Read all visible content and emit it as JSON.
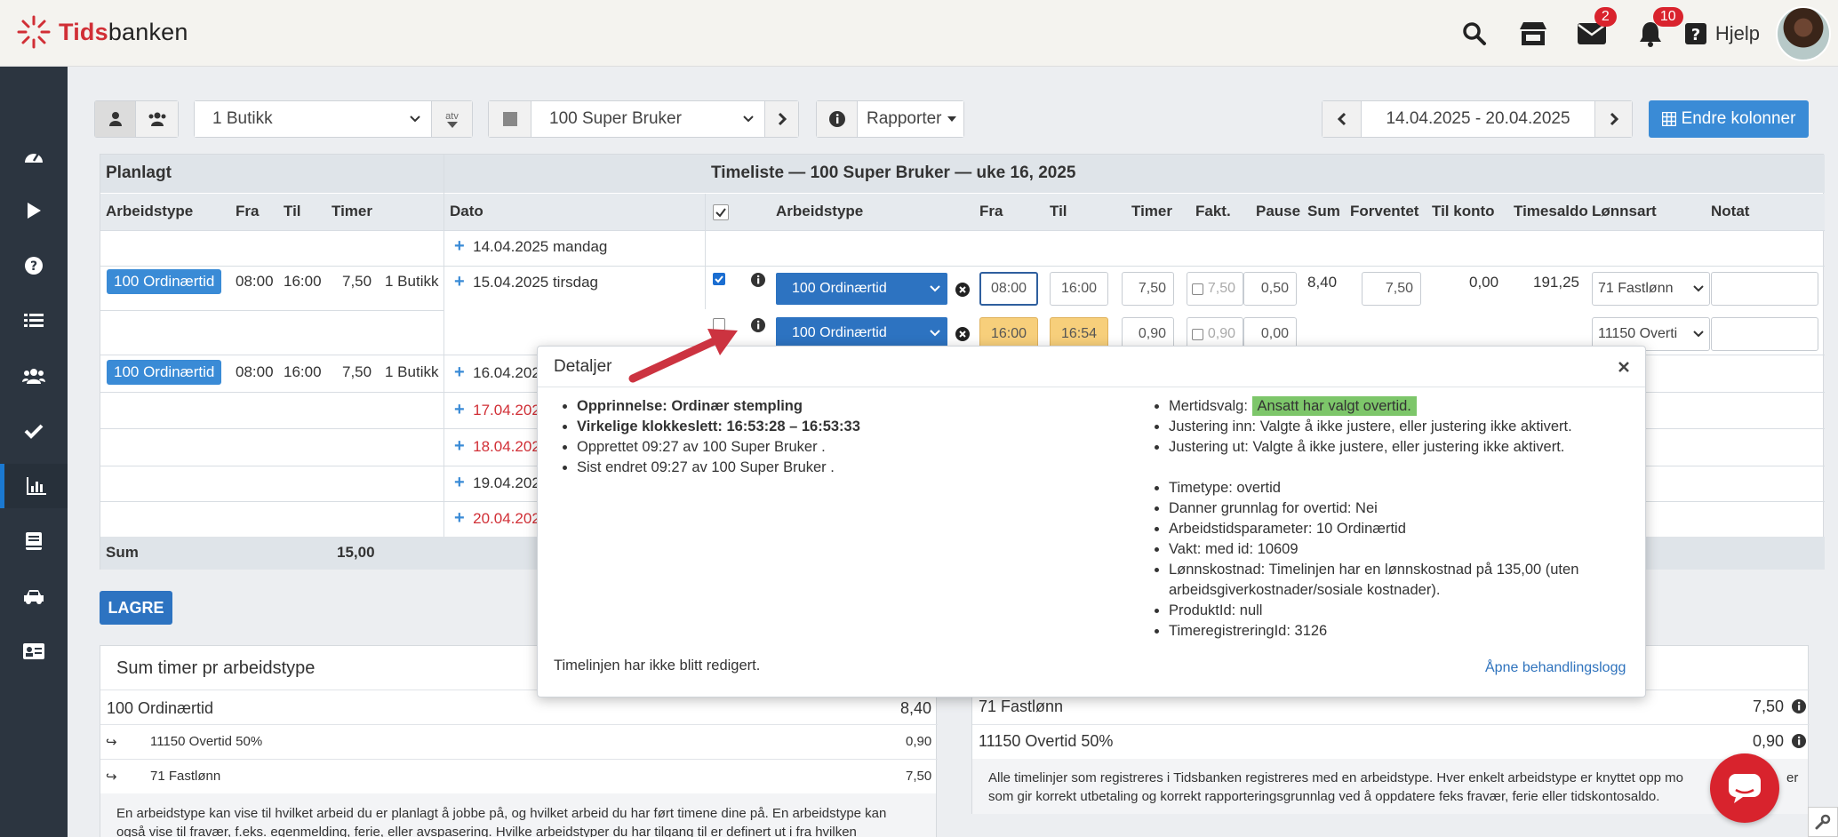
{
  "app": {
    "brand_red": "Tids",
    "brand_dark": "banken"
  },
  "topbar": {
    "messages_badge": "2",
    "notifications_badge": "10",
    "help_label": "Hjelp"
  },
  "toolbar": {
    "store_select": "1 Butikk",
    "atv_label": "atv",
    "user_select": "100 Super Bruker",
    "reports_label": "Rapporter",
    "date_range": "14.04.2025 - 20.04.2025",
    "change_columns_label": "Endre kolonner"
  },
  "table": {
    "planned_title": "Planlagt",
    "timesheet_title": "Timeliste — 100 Super Bruker — uke 16, 2025",
    "planned_headers": [
      "Arbeidstype",
      "Fra",
      "Til",
      "Timer"
    ],
    "headers": [
      "Dato",
      "Arbeidstype",
      "Fra",
      "Til",
      "Timer",
      "Fakt.",
      "Pause",
      "Sum",
      "Forventet",
      "Til konto",
      "Timesaldo",
      "Lønnsart",
      "Notat"
    ],
    "dates": [
      "14.04.2025 mandag",
      "15.04.2025 tirsdag",
      "16.04.202",
      "17.04.202",
      "18.04.202",
      "19.04.202",
      "20.04.202"
    ],
    "planned": {
      "type": "100 Ordinærtid",
      "from": "08:00",
      "to": "16:00",
      "hours": "7,50",
      "store": "1 Butikk"
    },
    "row1": {
      "type": "100 Ordinærtid",
      "from": "08:00",
      "to": "16:00",
      "hours": "7,50",
      "fakt": "7,50",
      "pause": "0,50",
      "sum": "8,40",
      "expected": "7,50",
      "to_account": "0,00",
      "balance": "191,25",
      "wage": "71 Fastlønn"
    },
    "row2": {
      "type": "100 Ordinærtid",
      "from": "16:00",
      "to": "16:54",
      "hours": "0,90",
      "fakt": "0,90",
      "pause": "0,00",
      "wage": "11150 Overti"
    },
    "sum_label": "Sum",
    "sum_value": "15,00"
  },
  "save_label": "LAGRE",
  "summary_left": {
    "title": "Sum timer pr arbeidstype",
    "rows": [
      {
        "label": "100 Ordinærtid",
        "value": "8,40"
      },
      {
        "label": "11150 Overtid 50%",
        "value": "0,90"
      },
      {
        "label": "71 Fastlønn",
        "value": "7,50"
      }
    ],
    "text": "En arbeidstype kan vise til hvilket arbeid du er planlagt å jobbe på, og hvilket arbeid du har ført timene dine på. En arbeidstype kan også vise til fravær, f.eks. egenmelding, ferie, eller avspasering. Hvilke arbeidstyper du har tilgang til er definert ut i fra hvilken"
  },
  "summary_right": {
    "rows": [
      {
        "label": "71 Fastlønn",
        "value": "7,50"
      },
      {
        "label": "11150 Overtid 50%",
        "value": "0,90"
      }
    ],
    "text1": "Alle timelinjer som registreres i Tidsbanken registreres med en arbeidstype. Hver enkelt arbeidstype er knyttet opp mo",
    "text1b": "er",
    "text2": "som gir korrekt utbetaling og korrekt rapporteringsgrunnlag ved å oppdatere feks fravær, ferie eller tidskontosaldo."
  },
  "popup": {
    "title": "Detaljer",
    "left": [
      {
        "label": "Opprinnelse: Ordinær stempling",
        "bold": true
      },
      {
        "label": "Virkelige klokkeslett: 16:53:28 – 16:53:33",
        "bold": true
      },
      {
        "label": "Opprettet 09:27 av 100 Super Bruker .",
        "bold": false
      },
      {
        "label": "Sist endret 09:27 av 100 Super Bruker .",
        "bold": false
      }
    ],
    "overtime_label": "Mertidsvalg: ",
    "overtime_value": "Ansatt har valgt overtid.",
    "adj_in": "Justering inn: Valgte å ikke justere, eller justering ikke aktivert.",
    "adj_out": "Justering ut: Valgte å ikke justere, eller justering ikke aktivert.",
    "right": [
      "Timetype: overtid",
      "Danner grunnlag for overtid: Nei",
      "Arbeidstidsparameter: 10 Ordinærtid",
      "Vakt: med id: 10609",
      "Lønnskostnad: Timelinjen har en lønnskostnad på 135,00 (uten",
      "arbeidsgiverkostnader/sosiale kostnader).",
      "ProduktId: null",
      "TimeregistreringId: 3126"
    ],
    "footer_text": "Timelinjen har ikke blitt redigert.",
    "log_link": "Åpne behandlingslogg"
  }
}
